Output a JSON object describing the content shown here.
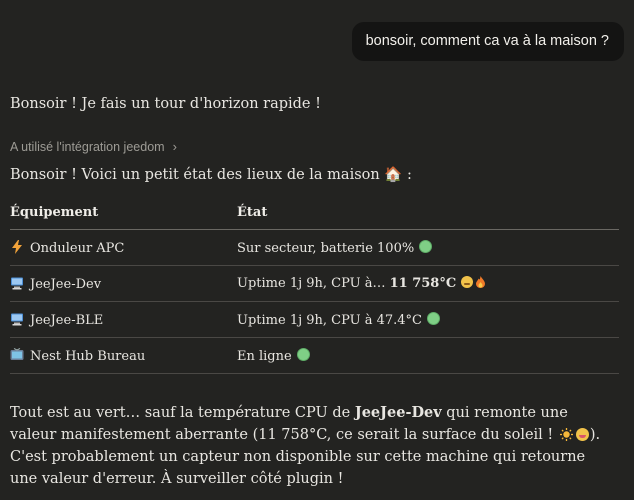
{
  "user_message": "bonsoir, comment ca va à la maison ?",
  "reply": {
    "intro": "Bonsoir ! Je fais un tour d'horizon rapide !",
    "tool_use": "A utilisé l'intégration jeedom",
    "heading": "Bonsoir ! Voici un petit état des lieux de la maison 🏠 :",
    "table": {
      "headers": [
        "Équipement",
        "État"
      ],
      "rows": [
        {
          "icon": "lightning-icon",
          "name": "Onduleur APC",
          "state": "Sur secteur, batterie 100%",
          "state_bold": "",
          "badge": "green-circle"
        },
        {
          "icon": "computer-icon",
          "name": "JeeJee-Dev",
          "state": "Uptime 1j 9h, CPU à… ",
          "state_bold": "11 758°C",
          "badge": "face-fire"
        },
        {
          "icon": "computer-icon",
          "name": "JeeJee-BLE",
          "state": "Uptime 1j 9h, CPU à 47.4°C",
          "state_bold": "",
          "badge": "green-circle"
        },
        {
          "icon": "tv-icon",
          "name": "Nest Hub Bureau",
          "state": "En ligne",
          "state_bold": "",
          "badge": "green-circle"
        }
      ]
    },
    "summary": {
      "part1": "Tout est au vert… sauf la température CPU de ",
      "bold": "JeeJee-Dev",
      "part2": " qui remonte une valeur manifestement aberrante (11 758°C, ce serait la surface du soleil ! ",
      "part3": "). C'est probablement un capteur non disponible sur cette machine qui retourne une valeur d'erreur. À surveiller côté plugin !"
    }
  },
  "colors": {
    "background": "#232321",
    "user_bubble": "#141413",
    "muted_text": "#9d9b95",
    "status_green": "#7fcf86"
  }
}
